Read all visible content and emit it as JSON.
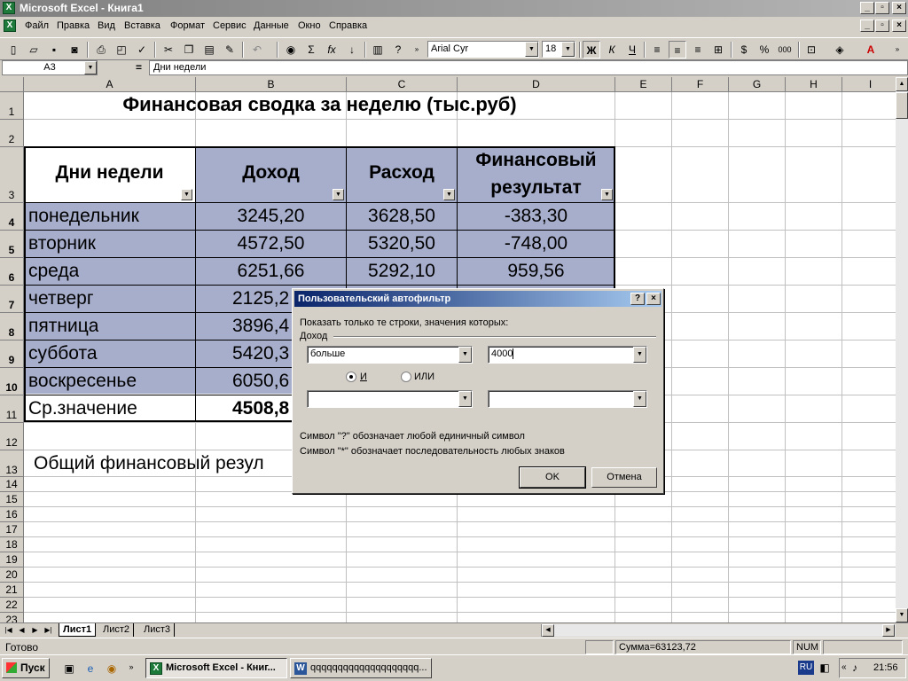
{
  "window": {
    "title": "Microsoft Excel - Книга1"
  },
  "menu": [
    "Файл",
    "Правка",
    "Вид",
    "Вставка",
    "Формат",
    "Сервис",
    "Данные",
    "Окно",
    "Справка"
  ],
  "toolbar": {
    "font": "Arial Cyr",
    "size": "18"
  },
  "formula": {
    "cell_ref": "A3",
    "content": "Дни недели"
  },
  "columns": [
    "A",
    "B",
    "C",
    "D",
    "E",
    "F",
    "G",
    "H",
    "I"
  ],
  "rows": [
    "1",
    "2",
    "3",
    "4",
    "5",
    "6",
    "7",
    "8",
    "9",
    "10",
    "11",
    "12",
    "13",
    "14",
    "15",
    "16",
    "17",
    "18",
    "19",
    "20",
    "21",
    "22",
    "23"
  ],
  "sheet": {
    "title": "Финансовая сводка за неделю (тыс.руб)",
    "headers": {
      "days": "Дни недели",
      "income": "Доход",
      "expense": "Расход",
      "result1": "Финансовый",
      "result2": "результат"
    },
    "data": [
      {
        "day": "понедельник",
        "income": "3245,20",
        "expense": "3628,50",
        "result": "-383,30"
      },
      {
        "day": "вторник",
        "income": "4572,50",
        "expense": "5320,50",
        "result": "-748,00"
      },
      {
        "day": "среда",
        "income": "6251,66",
        "expense": "5292,10",
        "result": "959,56"
      },
      {
        "day": "четверг",
        "income": "2125,2"
      },
      {
        "day": "пятница",
        "income": "3896,4"
      },
      {
        "day": "суббота",
        "income": "5420,3"
      },
      {
        "day": "воскресенье",
        "income": "6050,6"
      }
    ],
    "avg_label": "Ср.значение",
    "avg_value": "4508,8",
    "total_label": "Общий финансовый резул"
  },
  "tabs": [
    "Лист1",
    "Лист2",
    "Лист3"
  ],
  "status": {
    "ready": "Готово",
    "sum": "Сумма=63123,72",
    "num": "NUM"
  },
  "dialog": {
    "title": "Пользовательский автофильтр",
    "prompt": "Показать только те строки, значения которых:",
    "field": "Доход",
    "op1": "больше",
    "val1": "4000",
    "and_label": "И",
    "or_label": "ИЛИ",
    "op2": "",
    "val2": "",
    "hint1": "Символ \"?\" обозначает любой единичный символ",
    "hint2": "Символ \"*\" обозначает последовательность любых знаков",
    "ok": "OK",
    "cancel": "Отмена"
  },
  "taskbar": {
    "start": "Пуск",
    "task1": "Microsoft Excel - Книг...",
    "task2": "qqqqqqqqqqqqqqqqqqqq...",
    "lang": "RU",
    "clock": "21:56"
  }
}
